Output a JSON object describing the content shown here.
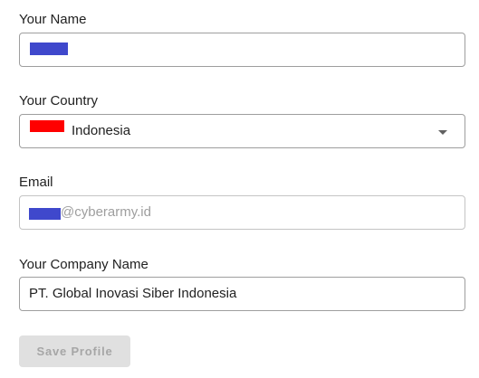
{
  "form": {
    "name": {
      "label": "Your Name",
      "value_redacted": true
    },
    "country": {
      "label": "Your Country",
      "value": "Indonesia",
      "flag_color": "#ff0000",
      "arrow_icon": "arrow-drop-down-icon"
    },
    "email": {
      "label": "Email",
      "value_suffix": "@cyberarmy.id",
      "value_prefix_redacted": true
    },
    "company": {
      "label": "Your Company Name",
      "value": "PT. Global Inovasi Siber Indonesia"
    },
    "save_button": {
      "label": "Save Profile",
      "disabled": true
    }
  },
  "colors": {
    "redaction": "#3f48cc",
    "border": "#9e9e9e",
    "label_text": "#212121",
    "placeholder_text": "#9e9e9e",
    "disabled_button_bg": "#e0e0e0",
    "disabled_button_text": "#a6a6a6"
  }
}
